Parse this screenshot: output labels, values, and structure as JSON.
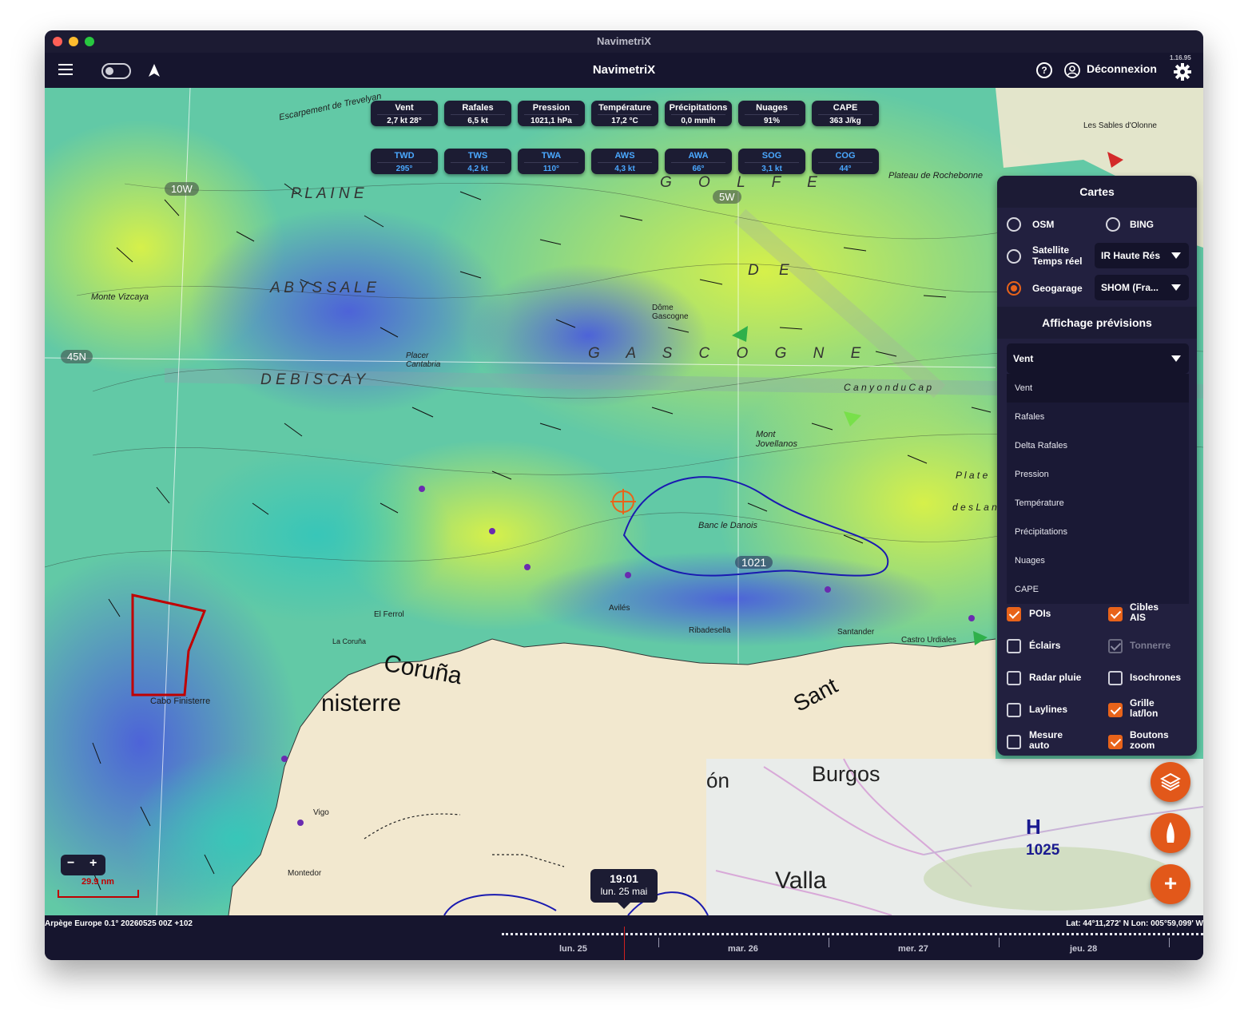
{
  "window": {
    "title": "NavimetriX"
  },
  "toolbar": {
    "app_title": "NavimetriX",
    "logout_label": "Déconnexion",
    "version": "1.16.95"
  },
  "weather_hud": [
    {
      "label": "Vent",
      "value": "2,7 kt 28°"
    },
    {
      "label": "Rafales",
      "value": "6,5 kt"
    },
    {
      "label": "Pression",
      "value": "1021,1 hPa"
    },
    {
      "label": "Température",
      "value": "17,2 °C"
    },
    {
      "label": "Précipitations",
      "value": "0,0 mm/h"
    },
    {
      "label": "Nuages",
      "value": "91%"
    },
    {
      "label": "CAPE",
      "value": "363 J/kg"
    }
  ],
  "nav_hud": [
    {
      "label": "TWD",
      "value": "295°"
    },
    {
      "label": "TWS",
      "value": "4,2 kt"
    },
    {
      "label": "TWA",
      "value": "110°"
    },
    {
      "label": "AWS",
      "value": "4,3 kt"
    },
    {
      "label": "AWA",
      "value": "66°"
    },
    {
      "label": "SOG",
      "value": "3,1 kt"
    },
    {
      "label": "COG",
      "value": "44°"
    }
  ],
  "map_labels": {
    "lon_10w": "10W",
    "lon_5w": "5W",
    "lat_45n": "45N",
    "plaine": "P L A I N E",
    "abyssale": "A B Y S S A L E",
    "biscay": "D E   B I S C A Y",
    "golfe": "G O L F E",
    "de": "D E",
    "gascogne": "G A S C O G N E",
    "monte_vizcaya": "Monte Vizcaya",
    "banc_danois": "Banc le Danois",
    "mont_jovellanos": "Mont Jovellanos",
    "coruna": "Coruña",
    "nisterre": "nisterre",
    "santander": "Santander",
    "ribadesella": "Ribadesella",
    "el_ferrol": "El Ferrol",
    "la_coruna": "La Coruña",
    "aviles": "Avilés",
    "castro": "Castro Urdiales",
    "vigo": "Vigo",
    "montedor": "Montedor",
    "cabo_finisterre": "Cabo Finisterre",
    "les_sables": "Les Sables d'Olonne",
    "plateau": "Plateau de Rochebonne",
    "escarpement": "Escarpement de Trevelyan",
    "burgos": "Burgos",
    "valla": "Valla",
    "on": "ón",
    "sant": "Sant",
    "isobar": "1021",
    "high_letter": "H",
    "high_value": "1025",
    "canyon": "C a n y o n   d u   C a p",
    "plate": "P l a t e",
    "des_lan": "d e s   L a n",
    "placer": "Placer Cantabria",
    "dome": "Dôme Gascogne"
  },
  "cartes_panel": {
    "title": "Cartes",
    "osm": "OSM",
    "bing": "BING",
    "satellite": "Satellite Temps réel",
    "satellite_select": "IR Haute Rés",
    "geogarage": "Geogarage",
    "geogarage_select": "SHOM (Fra...",
    "forecast_title": "Affichage prévisions",
    "forecast_selected": "Vent",
    "forecast_options": [
      "Vent",
      "Rafales",
      "Delta Rafales",
      "Pression",
      "Température",
      "Précipitations",
      "Nuages",
      "CAPE"
    ],
    "checkboxes": [
      {
        "label": "POIs",
        "checked": true
      },
      {
        "label": "Cibles AIS",
        "checked": true
      },
      {
        "label": "Éclairs",
        "checked": false
      },
      {
        "label": "Tonnerre",
        "checked": true,
        "disabled": true
      },
      {
        "label": "Radar pluie",
        "checked": false
      },
      {
        "label": "Isochrones",
        "checked": false
      },
      {
        "label": "Laylines",
        "checked": false
      },
      {
        "label": "Grille lat/lon",
        "checked": true
      },
      {
        "label": "Mesure auto",
        "checked": false
      },
      {
        "label": "Boutons zoom",
        "checked": true
      }
    ]
  },
  "zoom": {
    "minus": "−",
    "plus": "+"
  },
  "scale": "29.9 nm",
  "time_marker": {
    "time": "19:01",
    "date": "lun. 25 mai"
  },
  "status": {
    "model": "Arpège Europe 0.1° 20260525 00Z +102",
    "position": "Lat: 44°11,272' N Lon: 005°59,099' W"
  },
  "timeline_days": [
    "lun. 25",
    "mar. 26",
    "mer. 27",
    "jeu. 28"
  ],
  "colors": {
    "accent": "#e8631a",
    "bg": "#16152e",
    "hud_blue": "#4aa8ff"
  }
}
